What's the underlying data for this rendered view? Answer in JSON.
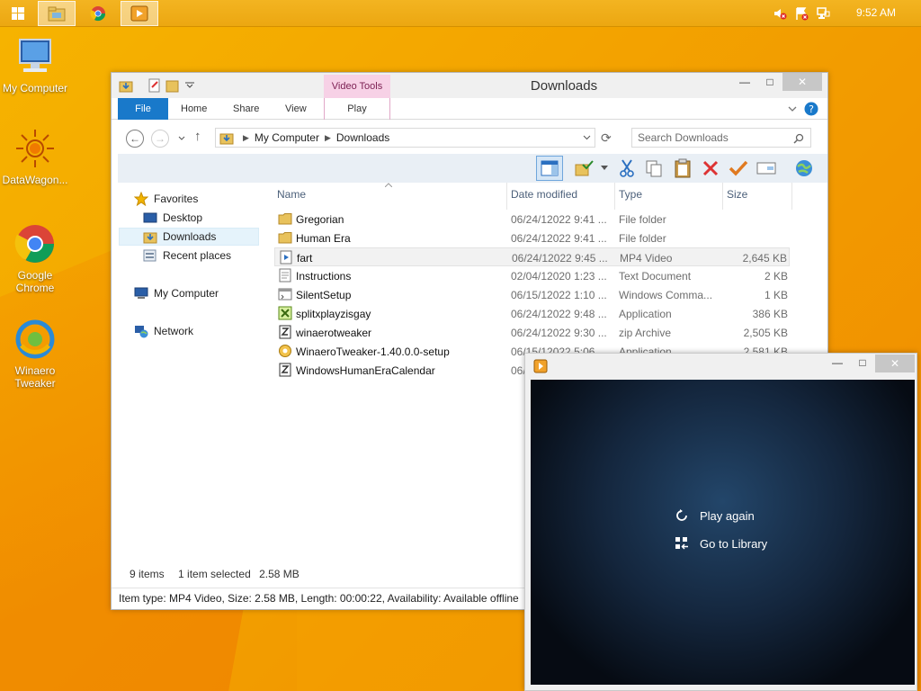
{
  "taskbar": {
    "clock": "9:52 AM"
  },
  "desktop": {
    "icons": [
      {
        "label": "My Computer"
      },
      {
        "label": "DataWagon..."
      },
      {
        "label": "Google Chrome"
      },
      {
        "label": "Winaero Tweaker"
      }
    ]
  },
  "explorer": {
    "title": "Downloads",
    "contextual_tab": "Video Tools",
    "ribbon_tabs": [
      "File",
      "Home",
      "Share",
      "View",
      "Play"
    ],
    "breadcrumb": [
      "My Computer",
      "Downloads"
    ],
    "search_placeholder": "Search Downloads",
    "nav": {
      "favorites": "Favorites",
      "desktop": "Desktop",
      "downloads": "Downloads",
      "recent": "Recent places",
      "computer": "My Computer",
      "network": "Network"
    },
    "columns": [
      "Name",
      "Date modified",
      "Type",
      "Size"
    ],
    "files": [
      {
        "name": "Gregorian",
        "date": "06/24/12022 9:41 ...",
        "type": "File folder",
        "size": "",
        "icon": "folder-icon"
      },
      {
        "name": "Human Era",
        "date": "06/24/12022 9:41 ...",
        "type": "File folder",
        "size": "",
        "icon": "folder-icon"
      },
      {
        "name": "fart",
        "date": "06/24/12022 9:45 ...",
        "type": "MP4 Video",
        "size": "2,645 KB",
        "icon": "video-file-icon"
      },
      {
        "name": "Instructions",
        "date": "02/04/12020 1:23 ...",
        "type": "Text Document",
        "size": "2 KB",
        "icon": "text-file-icon"
      },
      {
        "name": "SilentSetup",
        "date": "06/15/12022 1:10 ...",
        "type": "Windows Comma...",
        "size": "1 KB",
        "icon": "script-file-icon"
      },
      {
        "name": "splitxplayzisgay",
        "date": "06/24/12022 9:48 ...",
        "type": "Application",
        "size": "386 KB",
        "icon": "app-file-icon"
      },
      {
        "name": "winaerotweaker",
        "date": "06/24/12022 9:30 ...",
        "type": "zip Archive",
        "size": "2,505 KB",
        "icon": "zip-file-icon"
      },
      {
        "name": "WinaeroTweaker-1.40.0.0-setup",
        "date": "06/15/12022 5:06 ...",
        "type": "Application",
        "size": "2,581 KB",
        "icon": "setup-file-icon"
      },
      {
        "name": "WindowsHumanEraCalendar",
        "date": "06/",
        "type": "",
        "size": "",
        "icon": "zip-file-icon"
      }
    ],
    "status": {
      "count": "9 items",
      "selected": "1 item selected",
      "size": "2.58 MB",
      "details": "Item type: MP4 Video, Size: 2.58 MB, Length: 00:00:22, Availability: Available offline"
    }
  },
  "player": {
    "actions": [
      "Play again",
      "Go to Library"
    ]
  },
  "colors": {
    "accent": "#1979ca",
    "contextual": "#f7d1e6",
    "taskbar": "#f1ae1a"
  }
}
